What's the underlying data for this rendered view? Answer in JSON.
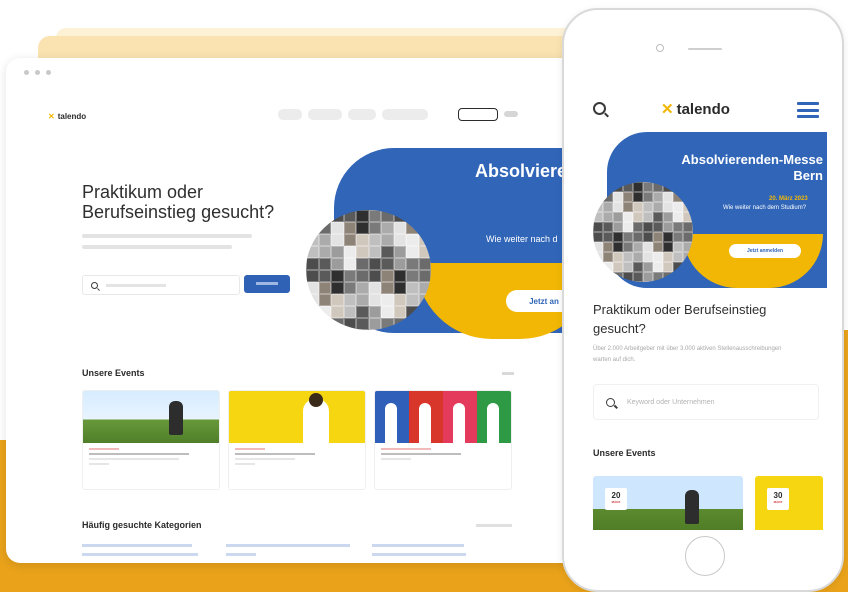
{
  "colors": {
    "brand_blue": "#3065b8",
    "brand_yellow": "#f2b705",
    "background_gold": "#e9a21a",
    "peach": "#fbe3b1"
  },
  "brand": {
    "logo_mark": "✕",
    "logo_text": "talendo"
  },
  "desktop": {
    "hero_title": "Praktikum oder Berufseinstieg gesucht?",
    "banner": {
      "title": "Absolvierenden-Messe",
      "subtitle": "Wie weiter nach d",
      "button": "Jetzt an"
    },
    "events_title": "Unsere Events",
    "categories_title": "Häufig gesuchte Kategorien"
  },
  "mobile": {
    "banner": {
      "title": "Absolvierenden-Messe Bern",
      "date": "20. März 2023",
      "subtitle": "Wie weiter nach dem Studium?",
      "button": "Jetzt anmelden"
    },
    "hero_title": "Praktikum oder Berufseinstieg gesucht?",
    "hero_subtitle": "Über 2.000 Arbeitgeber mit über 3.000 aktiven Stellenausschreibungen warten auf dich.",
    "search_placeholder": "Keyword oder Unternehmen",
    "events_title": "Unsere Events",
    "event_cards": [
      {
        "day": "20",
        "month": "MÄRZ"
      },
      {
        "day": "30",
        "month": "MÄRZ"
      }
    ]
  },
  "icons": {
    "search": "search-icon",
    "menu": "hamburger-menu-icon"
  }
}
